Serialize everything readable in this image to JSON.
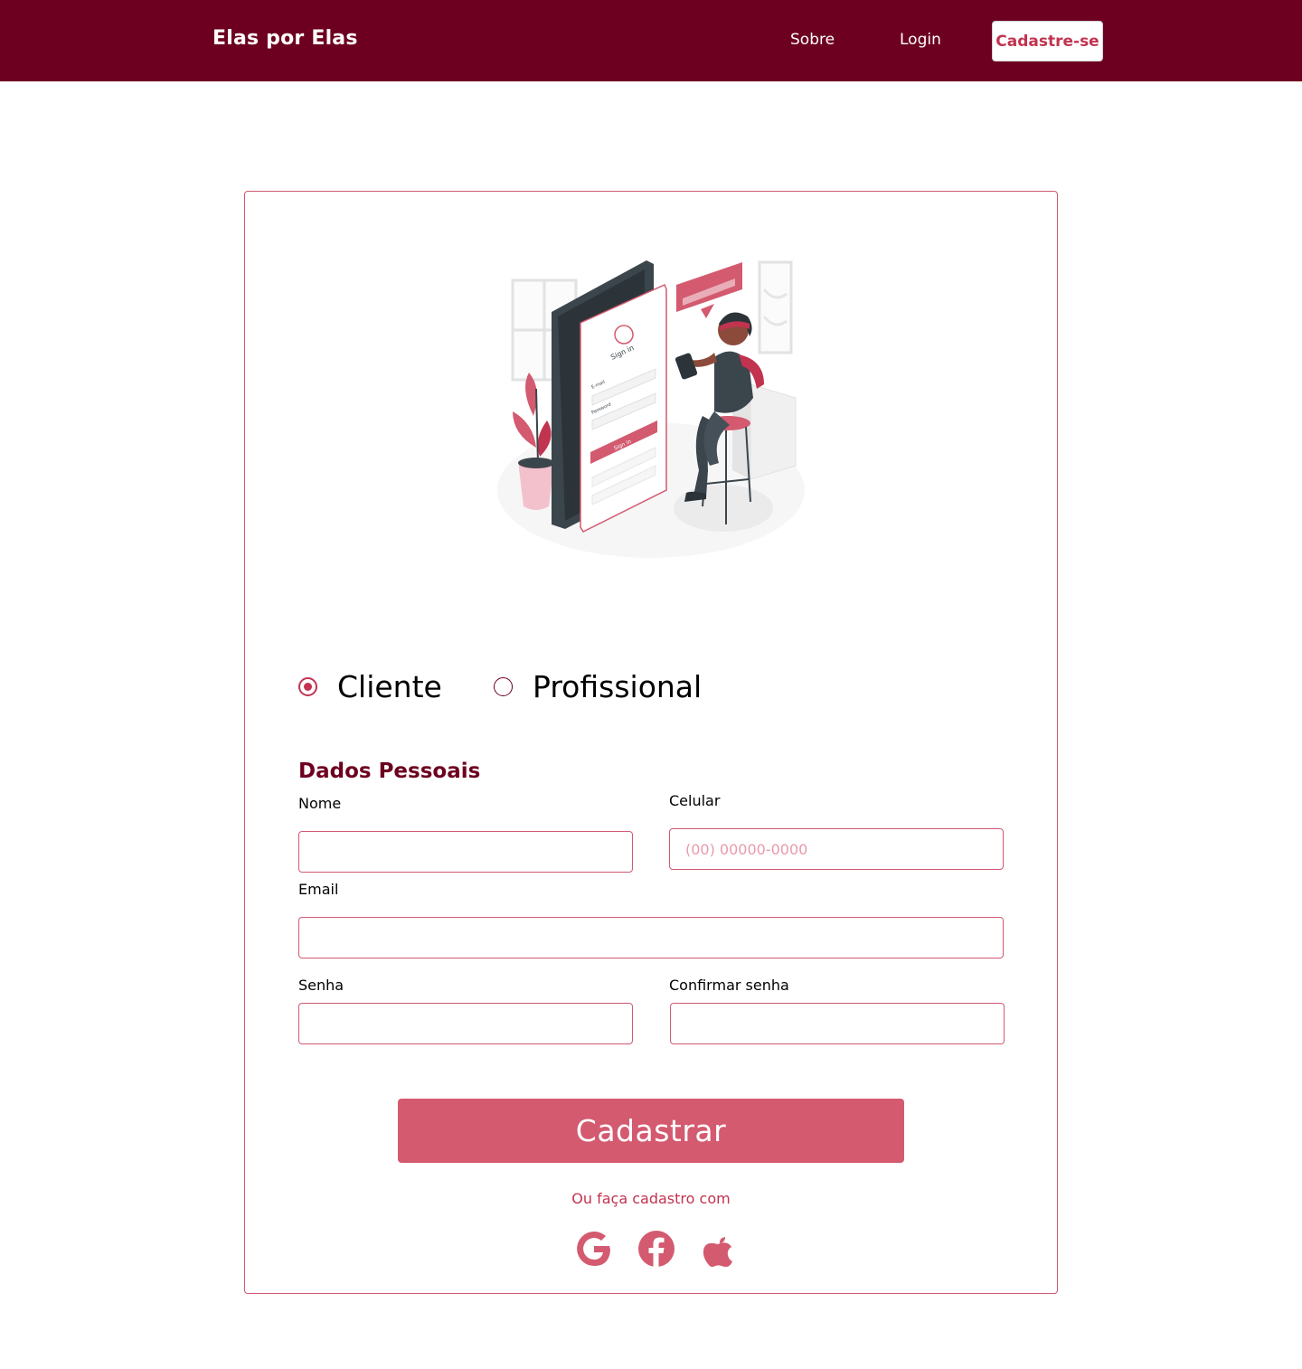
{
  "header": {
    "brand": "Elas por Elas",
    "nav": {
      "sobre": "Sobre",
      "login": "Login",
      "cadastro": "Cadastre-se"
    }
  },
  "illustration": {
    "icon": "sign-in-illustration",
    "screen_title": "Sign in",
    "email_label": "E-mail",
    "password_label": "Password",
    "button_label": "Sign in"
  },
  "account_type": {
    "options": [
      "Cliente",
      "Profissional"
    ],
    "selected": "Cliente"
  },
  "form": {
    "section_title": "Dados Pessoais",
    "nome_label": "Nome",
    "celular_label": "Celular",
    "celular_placeholder": "(00) 00000-0000",
    "email_label": "Email",
    "senha_label": "Senha",
    "confirmar_label": "Confirmar senha",
    "submit_label": "Cadastrar"
  },
  "social_login": {
    "text": "Ou faça cadastro com",
    "icons": [
      "google-icon",
      "facebook-icon",
      "apple-icon"
    ]
  },
  "colors": {
    "primary_dark": "#6d0020",
    "accent": "#c2334f",
    "button": "#d35a6f",
    "border": "#cf5a72"
  }
}
